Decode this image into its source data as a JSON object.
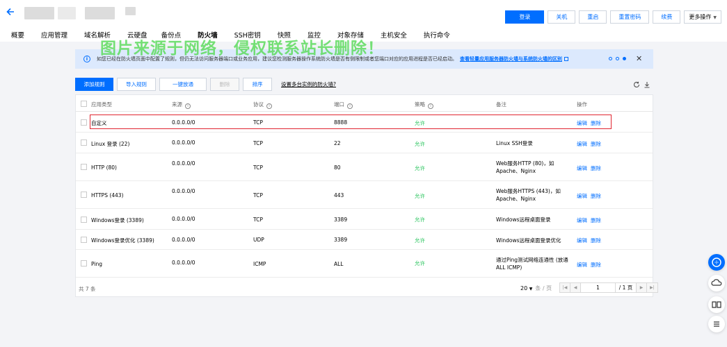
{
  "header": {
    "actions": [
      {
        "label": "登录",
        "primary": true
      },
      {
        "label": "关机"
      },
      {
        "label": "重启"
      },
      {
        "label": "重置密码"
      },
      {
        "label": "续费"
      }
    ],
    "more_label": "更多操作",
    "watermark": "图片来源于网络，侵权联系站长删除！"
  },
  "tabs": [
    {
      "label": "概要"
    },
    {
      "label": "应用管理"
    },
    {
      "label": "域名解析"
    },
    {
      "label": "云硬盘"
    },
    {
      "label": "备份点"
    },
    {
      "label": "防火墙",
      "active": true
    },
    {
      "label": "SSH密钥"
    },
    {
      "label": "快照"
    },
    {
      "label": "监控"
    },
    {
      "label": "对象存储"
    },
    {
      "label": "主机安全"
    },
    {
      "label": "执行命令"
    }
  ],
  "notice": {
    "text": "如您已经在防火墙页面中配置了规则，但仍无法访问服务器端口或业务应用，建议您检测服务器操作系统防火墙是否有侧限制或者您端口对应的应用进程是否已经启动。",
    "link": "查看轻量应用服务器防火墙与系统防火墙的区别"
  },
  "toolbar": {
    "add": "添加规则",
    "import": "导入规则",
    "open_all": "一键放通",
    "delete": "删除",
    "sort": "排序",
    "multi_link": "设置多台实例的防火墙?"
  },
  "table": {
    "headers": {
      "app": "应用类型",
      "source": "来源",
      "protocol": "协议",
      "port": "端口",
      "policy": "策略",
      "remark": "备注",
      "ops": "操作"
    },
    "rows": [
      {
        "app": "自定义",
        "source": "0.0.0.0/0",
        "protocol": "TCP",
        "port": "8888",
        "policy": "允许",
        "remark": ""
      },
      {
        "app": "Linux 登录 (22)",
        "source": "0.0.0.0/0",
        "protocol": "TCP",
        "port": "22",
        "policy": "允许",
        "remark": "Linux SSH登录"
      },
      {
        "app": "HTTP (80)",
        "source": "0.0.0.0/0",
        "protocol": "TCP",
        "port": "80",
        "policy": "允许",
        "remark": "Web服务HTTP (80)，如 Apache、Nginx"
      },
      {
        "app": "HTTPS (443)",
        "source": "0.0.0.0/0",
        "protocol": "TCP",
        "port": "443",
        "policy": "允许",
        "remark": "Web服务HTTPS (443)，如 Apache、Nginx"
      },
      {
        "app": "Windows登录 (3389)",
        "source": "0.0.0.0/0",
        "protocol": "TCP",
        "port": "3389",
        "policy": "允许",
        "remark": "Windows远程桌面登录"
      },
      {
        "app": "Windows登录优化 (3389)",
        "source": "0.0.0.0/0",
        "protocol": "UDP",
        "port": "3389",
        "policy": "允许",
        "remark": "Windows远程桌面登录优化"
      },
      {
        "app": "Ping",
        "source": "0.0.0.0/0",
        "protocol": "ICMP",
        "port": "ALL",
        "policy": "允许",
        "remark": "通过Ping测试网络连通性 (放通 ALL ICMP)"
      }
    ],
    "edit_label": "编辑",
    "delete_label": "删除"
  },
  "footer": {
    "total": "共 7 条",
    "page_size": "20",
    "page_size_unit": "条 / 页",
    "page_input": "1",
    "page_total": "/ 1 页"
  },
  "colors": {
    "accent": "#006eff",
    "allow": "#29c45d",
    "highlight": "#e0242f"
  }
}
